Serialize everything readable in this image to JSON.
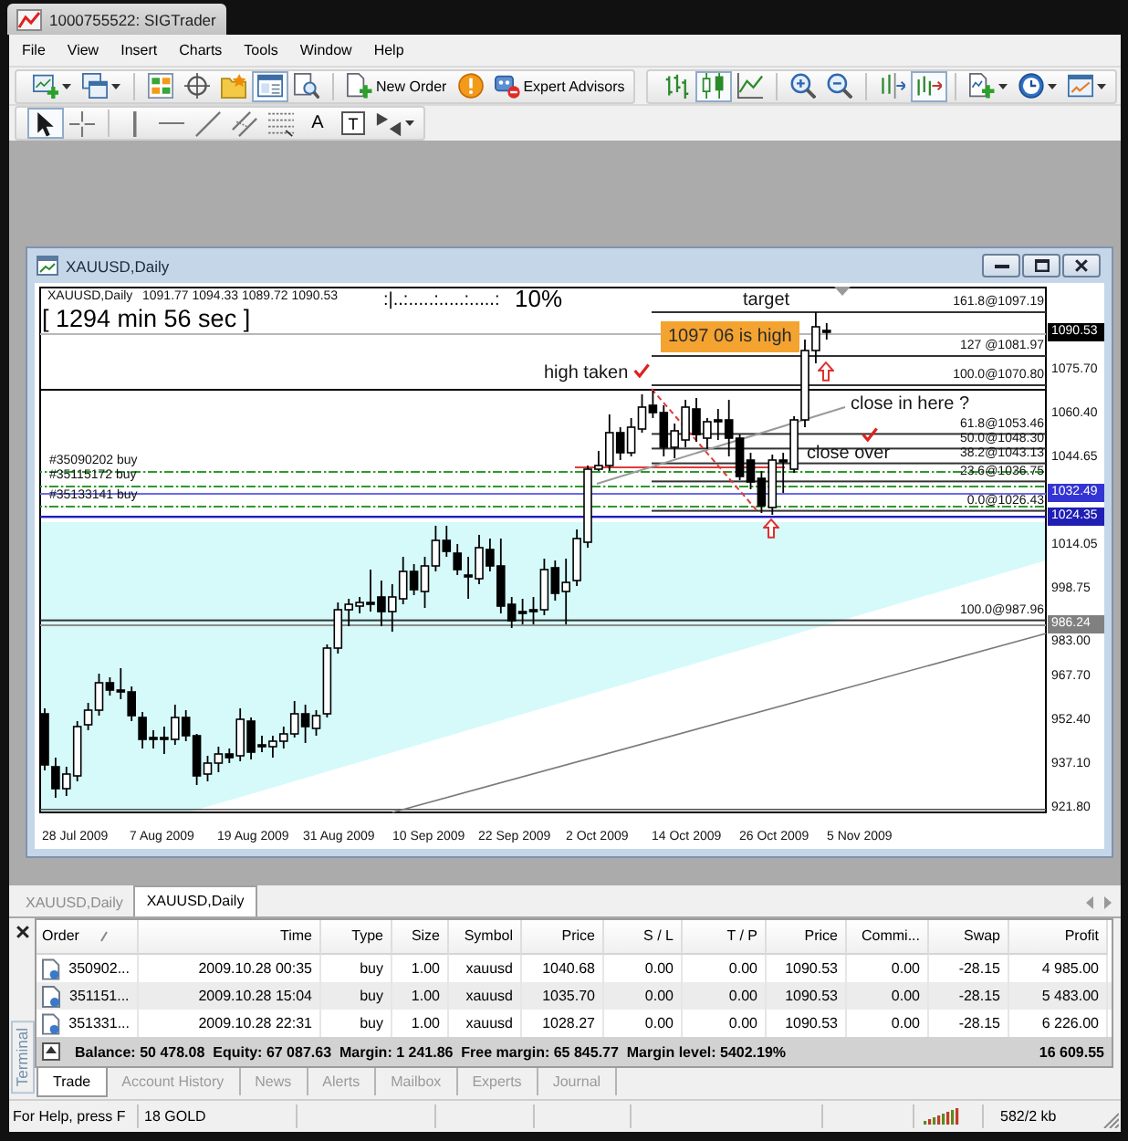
{
  "window": {
    "title": "1000755522: SIGTrader"
  },
  "menu": [
    "File",
    "View",
    "Insert",
    "Charts",
    "Tools",
    "Window",
    "Help"
  ],
  "toolbars": [
    {
      "items": [
        {
          "kind": "new-chart",
          "pressed": false,
          "dropdown": true
        },
        {
          "kind": "profiles",
          "pressed": false,
          "dropdown": true
        },
        {
          "kind": "separator"
        },
        {
          "kind": "market-watch",
          "pressed": false
        },
        {
          "kind": "data-window",
          "pressed": false
        },
        {
          "kind": "navigator",
          "pressed": false
        },
        {
          "kind": "terminal",
          "pressed": true
        },
        {
          "kind": "tester",
          "pressed": false
        },
        {
          "kind": "separator"
        },
        {
          "kind": "new-order",
          "pressed": false,
          "label": "New Order"
        },
        {
          "kind": "editor",
          "pressed": false
        },
        {
          "kind": "experts",
          "pressed": false,
          "label": "Expert Advisors"
        }
      ]
    },
    {
      "items": [
        {
          "kind": "bar",
          "pressed": false
        },
        {
          "kind": "candle",
          "pressed": true
        },
        {
          "kind": "line",
          "pressed": false
        },
        {
          "kind": "separator"
        },
        {
          "kind": "zoom-in",
          "pressed": false
        },
        {
          "kind": "zoom-out",
          "pressed": false
        },
        {
          "kind": "separator"
        },
        {
          "kind": "shift",
          "pressed": false
        },
        {
          "kind": "autoscroll",
          "pressed": true
        },
        {
          "kind": "separator"
        },
        {
          "kind": "indicators",
          "pressed": false,
          "dropdown": true
        },
        {
          "kind": "periods",
          "pressed": false,
          "dropdown": true
        },
        {
          "kind": "templates",
          "pressed": false,
          "dropdown": true
        }
      ]
    }
  ],
  "drawing_toolbar": {
    "items": [
      {
        "kind": "cursor",
        "pressed": true
      },
      {
        "kind": "crosshair",
        "pressed": false
      },
      {
        "kind": "separator"
      },
      {
        "kind": "vline",
        "pressed": false
      },
      {
        "kind": "hline",
        "pressed": false
      },
      {
        "kind": "trend",
        "pressed": false
      },
      {
        "kind": "channel",
        "pressed": false
      },
      {
        "kind": "fibo",
        "pressed": false
      },
      {
        "kind": "text",
        "pressed": false,
        "glyph": "A"
      },
      {
        "kind": "label",
        "pressed": false,
        "glyph": "T"
      },
      {
        "kind": "arrows",
        "pressed": false,
        "dropdown": true
      }
    ]
  },
  "chart": {
    "title": "XAUUSD,Daily",
    "symbol": "XAUUSD,Daily",
    "ohlc": "1091.77 1094.33 1089.72 1090.53",
    "timer": "[ 1294 min 56 sec ]",
    "meter": ":|..:.....:.....:.....:",
    "meter_percent": "10%",
    "annotations": [
      {
        "kind": "text",
        "text": "target"
      },
      {
        "kind": "highlight",
        "text": "1097 06 is high"
      },
      {
        "kind": "text",
        "text": "high taken"
      },
      {
        "kind": "text",
        "text": "close in here ?"
      },
      {
        "kind": "text",
        "text": "close over"
      }
    ],
    "fibonacci_labels": [
      "161.8@1097.19",
      "127 @1081.97",
      "100.0@1070.80",
      "61.8@1053.46",
      "50.0@1048.30",
      "38.2@1043.13",
      "23.6@1036.75",
      "0.0@1026.43",
      "100.0@987.96"
    ],
    "order_labels": [
      "#35090202 buy",
      "#35115172 buy",
      "#35133141 buy"
    ],
    "price_labels": [
      {
        "text": "1090.53",
        "color": "#000000"
      },
      {
        "text": "1075.70"
      },
      {
        "text": "1060.40"
      },
      {
        "text": "1044.65"
      },
      {
        "text": "1032.49",
        "color": "#3434d4"
      },
      {
        "text": "1024.35",
        "color": "#1f1fb4"
      },
      {
        "text": "1014.05"
      },
      {
        "text": "998.75"
      },
      {
        "text": "986.24",
        "color": "#808080"
      },
      {
        "text": "983.00"
      },
      {
        "text": "967.70"
      },
      {
        "text": "952.40"
      },
      {
        "text": "937.10"
      },
      {
        "text": "921.80"
      }
    ],
    "date_labels": [
      "28 Jul 2009",
      "7 Aug 2009",
      "19 Aug 2009",
      "31 Aug 2009",
      "10 Sep 2009",
      "22 Sep 2009",
      "2 Oct 2009",
      "14 Oct 2009",
      "26 Oct 2009",
      "5 Nov 2009"
    ]
  },
  "chart_tabs": [
    {
      "label": "XAUUSD,Daily",
      "selected": false
    },
    {
      "label": "XAUUSD,Daily",
      "selected": true
    }
  ],
  "terminal": {
    "title": "Terminal",
    "columns": [
      "Order",
      "Time",
      "Type",
      "Size",
      "Symbol",
      "Price",
      "S / L",
      "T / P",
      "Price",
      "Commi...",
      "Swap",
      "Profit"
    ],
    "rows": [
      [
        "350902...",
        "2009.10.28 00:35",
        "buy",
        "1.00",
        "xauusd",
        "1040.68",
        "0.00",
        "0.00",
        "1090.53",
        "0.00",
        "-28.15",
        "4 985.00"
      ],
      [
        "351151...",
        "2009.10.28 15:04",
        "buy",
        "1.00",
        "xauusd",
        "1035.70",
        "0.00",
        "0.00",
        "1090.53",
        "0.00",
        "-28.15",
        "5 483.00"
      ],
      [
        "351331...",
        "2009.10.28 22:31",
        "buy",
        "1.00",
        "xauusd",
        "1028.27",
        "0.00",
        "0.00",
        "1090.53",
        "0.00",
        "-28.15",
        "6 226.00"
      ]
    ],
    "summary": "Balance: 50 478.08  Equity: 67 087.63  Margin: 1 241.86  Free margin: 65 845.77  Margin level: 5402.19%",
    "total_profit": "16 609.55",
    "tabs": [
      {
        "label": "Trade",
        "selected": true
      },
      {
        "label": "Account History",
        "selected": false
      },
      {
        "label": "News",
        "selected": false
      },
      {
        "label": "Alerts",
        "selected": false
      },
      {
        "label": "Mailbox",
        "selected": false
      },
      {
        "label": "Experts",
        "selected": false
      },
      {
        "label": "Journal",
        "selected": false
      }
    ]
  },
  "status_bar": [
    "For Help, press F",
    "18 GOLD",
    "582/2 kb"
  ]
}
